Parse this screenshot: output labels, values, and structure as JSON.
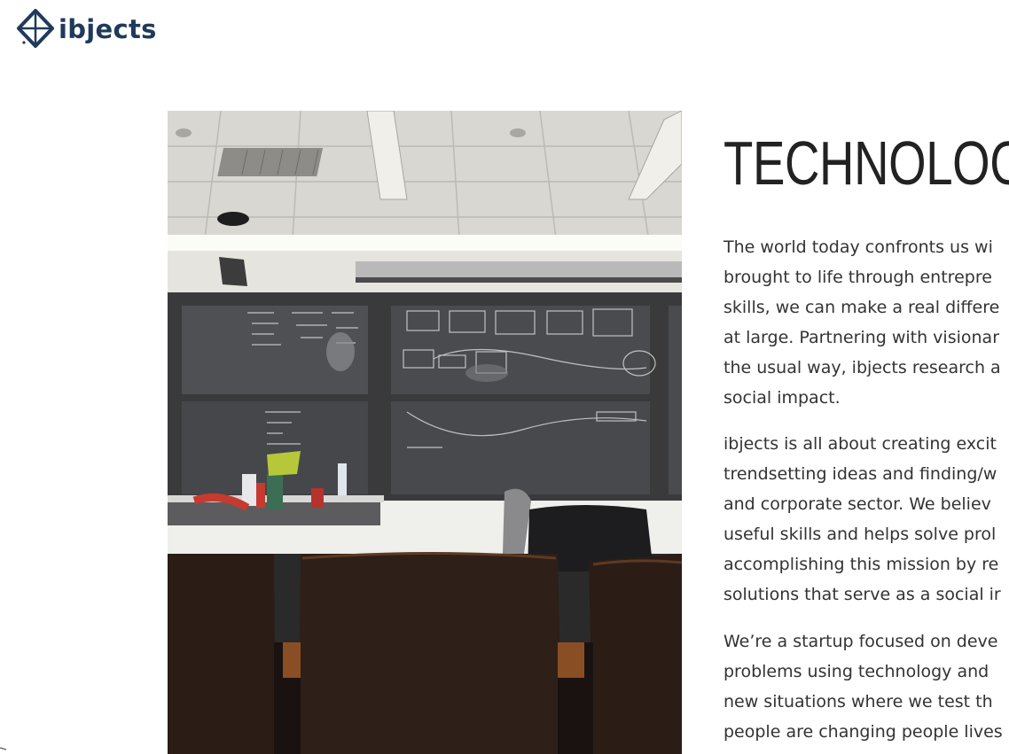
{
  "brand": {
    "name": "ibjects",
    "logo_icon": "diamond-compass-icon",
    "color": "#1f3a5a"
  },
  "hero": {
    "image": "classroom-chalkboard-photo"
  },
  "section": {
    "title": "TECHNOLOGY",
    "paragraphs": [
      {
        "lines": [
          "The world today confronts us wi",
          "brought to life through entrepre",
          "skills, we can make a real differe",
          "at large. Partnering with visionar",
          "the usual way, ibjects research a",
          "social impact."
        ]
      },
      {
        "lines": [
          "ibjects is all about creating excit",
          "trendsetting ideas and finding/w",
          "and corporate sector. We believ",
          "useful skills and helps solve prol",
          "accomplishing this mission by re",
          "solutions that serve as a social ir"
        ]
      },
      {
        "lines": [
          "We’re a startup focused on deve",
          "problems using technology and",
          "new situations where we test th",
          "people are changing people lives"
        ]
      }
    ]
  },
  "colors": {
    "text": "#333333",
    "heading": "#222222",
    "background": "#ffffff"
  }
}
